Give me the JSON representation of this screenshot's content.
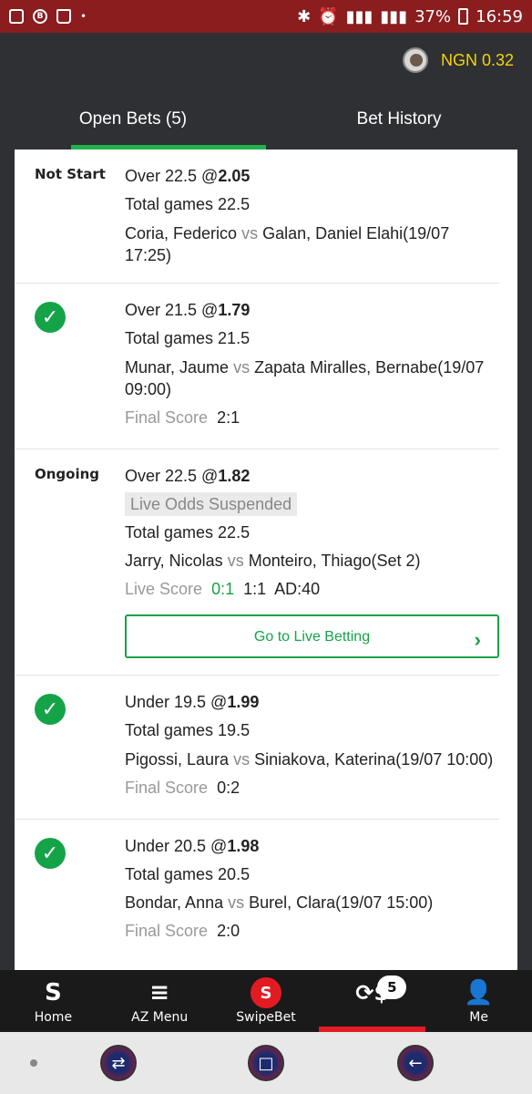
{
  "statusbar": {
    "battery": "37%",
    "time": "16:59"
  },
  "header": {
    "balance": "NGN 0.32"
  },
  "tabs": [
    {
      "label": "Open Bets (5)",
      "active": true
    },
    {
      "label": "Bet History",
      "active": false
    }
  ],
  "bets": [
    {
      "status": "Not Start",
      "selection": "Over 22.5 @",
      "odds": "2.05",
      "market": "Total games 22.5",
      "home": "Coria, Federico",
      "vs": "vs",
      "away_info": "Galan, Daniel Elahi(19/07 17:25)"
    },
    {
      "status": "won",
      "selection": "Over 21.5 @",
      "odds": "1.79",
      "market": "Total games 21.5",
      "home": "Munar, Jaume",
      "vs": "vs",
      "away_info": "Zapata Miralles, Bernabe(19/07 09:00)",
      "score_label": "Final Score",
      "score": "2:1"
    },
    {
      "status": "Ongoing",
      "selection": "Over 22.5 @",
      "odds": "1.82",
      "suspended": "Live Odds Suspended",
      "market": "Total games 22.5",
      "home": "Jarry, Nicolas",
      "vs": "vs",
      "away_info": "Monteiro, Thiago(Set 2)",
      "score_label": "Live Score",
      "live_sets": "0:1",
      "live_games": "1:1",
      "live_points": "AD:40",
      "button": "Go to Live Betting"
    },
    {
      "status": "won",
      "selection": "Under 19.5 @",
      "odds": "1.99",
      "market": "Total games 19.5",
      "home": "Pigossi, Laura",
      "vs": "vs",
      "away_info": "Siniakova, Katerina(19/07 10:00)",
      "score_label": "Final Score",
      "score": "0:2"
    },
    {
      "status": "won",
      "selection": "Under 20.5 @",
      "odds": "1.98",
      "market": "Total games 20.5",
      "home": "Bondar, Anna",
      "vs": "vs",
      "away_info": "Burel, Clara(19/07 15:00)",
      "score_label": "Final Score",
      "score": "2:0"
    }
  ],
  "bottom_nav": [
    {
      "label": "Home",
      "icon": "sportybet-s-icon"
    },
    {
      "label": "AZ Menu",
      "icon": "hamburger-icon"
    },
    {
      "label": "SwipeBet",
      "icon": "swipebet-icon"
    },
    {
      "label": "",
      "icon": "open-bets-icon",
      "badge": "5",
      "active": true
    },
    {
      "label": "Me",
      "icon": "user-icon"
    }
  ],
  "colors": {
    "statusbar": "#8b1d1f",
    "header": "#2e3034",
    "accent_green": "#15a347",
    "balance_yellow": "#f5d400",
    "nav_active_red": "#e21b23"
  }
}
